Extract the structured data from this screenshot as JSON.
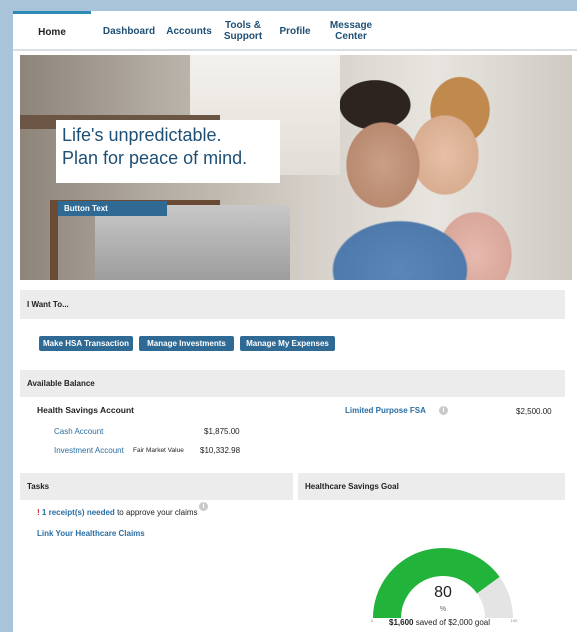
{
  "nav": {
    "items": [
      {
        "label": "Home"
      },
      {
        "label": "Dashboard"
      },
      {
        "label": "Accounts"
      },
      {
        "label": "Tools &\nSupport"
      },
      {
        "label": "Profile"
      },
      {
        "label": "Message\nCenter"
      }
    ]
  },
  "hero": {
    "headline_line1": "Life's unpredictable.",
    "headline_line2": "Plan for peace of mind.",
    "button_label": "Button Text"
  },
  "i_want_to": {
    "title": "I Want To...",
    "actions": [
      "Make HSA Transaction",
      "Manage Investments",
      "Manage My Expenses"
    ]
  },
  "balance": {
    "title": "Available Balance",
    "hsa": {
      "title": "Health Savings Account",
      "cash_label": "Cash Account",
      "cash_value": "$1,875.00",
      "investment_label": "Investment Account",
      "fmv_label": "Fair Market Value",
      "investment_value": "$10,332.98"
    },
    "lpfsa": {
      "title": "Limited Purpose FSA",
      "value": "$2,500.00",
      "info_icon": "info-icon"
    }
  },
  "tasks": {
    "title": "Tasks",
    "alert_mark": "!",
    "receipts_link": "1 receipt(s) needed",
    "receipts_suffix": "to approve your claims",
    "link_claims": "Link Your Healthcare Claims",
    "info_icon": "info-icon"
  },
  "goal": {
    "title": "Healthcare Savings Goal",
    "percent": 80,
    "percent_text": "80",
    "percent_unit": "%",
    "scale_min": "0",
    "scale_max": "100",
    "saved_amount": "$1,600",
    "saved_mid": "saved of",
    "goal_amount": "$2,000 goal",
    "fill_color": "#22b33a",
    "track_color": "#e4e4e4"
  },
  "colors": {
    "primary": "#2e6a94",
    "nav_text": "#1e4f75",
    "link": "#2a6ea3",
    "alert": "#d9232a",
    "page_bg": "#a9c3d8"
  }
}
